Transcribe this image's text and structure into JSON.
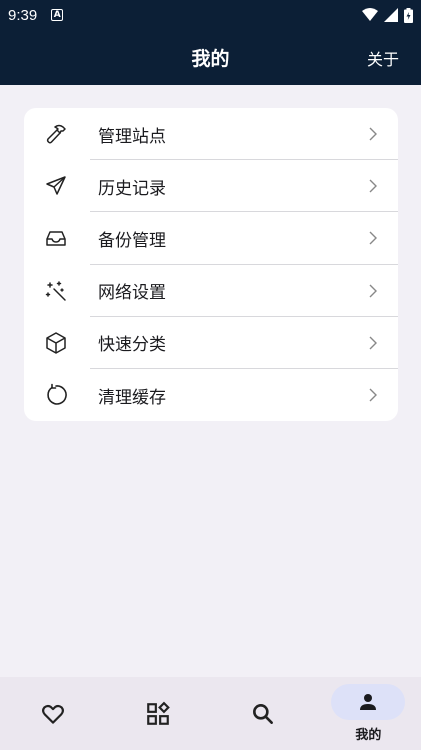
{
  "status": {
    "time": "9:39",
    "notif_letter": "A"
  },
  "appbar": {
    "title": "我的",
    "about_label": "关于"
  },
  "menu": {
    "items": [
      {
        "label": "管理站点",
        "icon": "hammer-icon"
      },
      {
        "label": "历史记录",
        "icon": "send-icon"
      },
      {
        "label": "备份管理",
        "icon": "inbox-icon"
      },
      {
        "label": "网络设置",
        "icon": "sparkles-icon"
      },
      {
        "label": "快速分类",
        "icon": "cube-icon"
      },
      {
        "label": "清理缓存",
        "icon": "refresh-icon"
      }
    ]
  },
  "bottom_nav": {
    "tabs": [
      {
        "icon": "heart-icon",
        "label": ""
      },
      {
        "icon": "grid-icon",
        "label": ""
      },
      {
        "icon": "search-icon",
        "label": ""
      },
      {
        "icon": "person-icon",
        "label": "我的",
        "active": true
      }
    ]
  },
  "colors": {
    "header_bg": "#0c1f36",
    "page_bg": "#f2f0f6",
    "active_pill": "#dde1f8"
  }
}
